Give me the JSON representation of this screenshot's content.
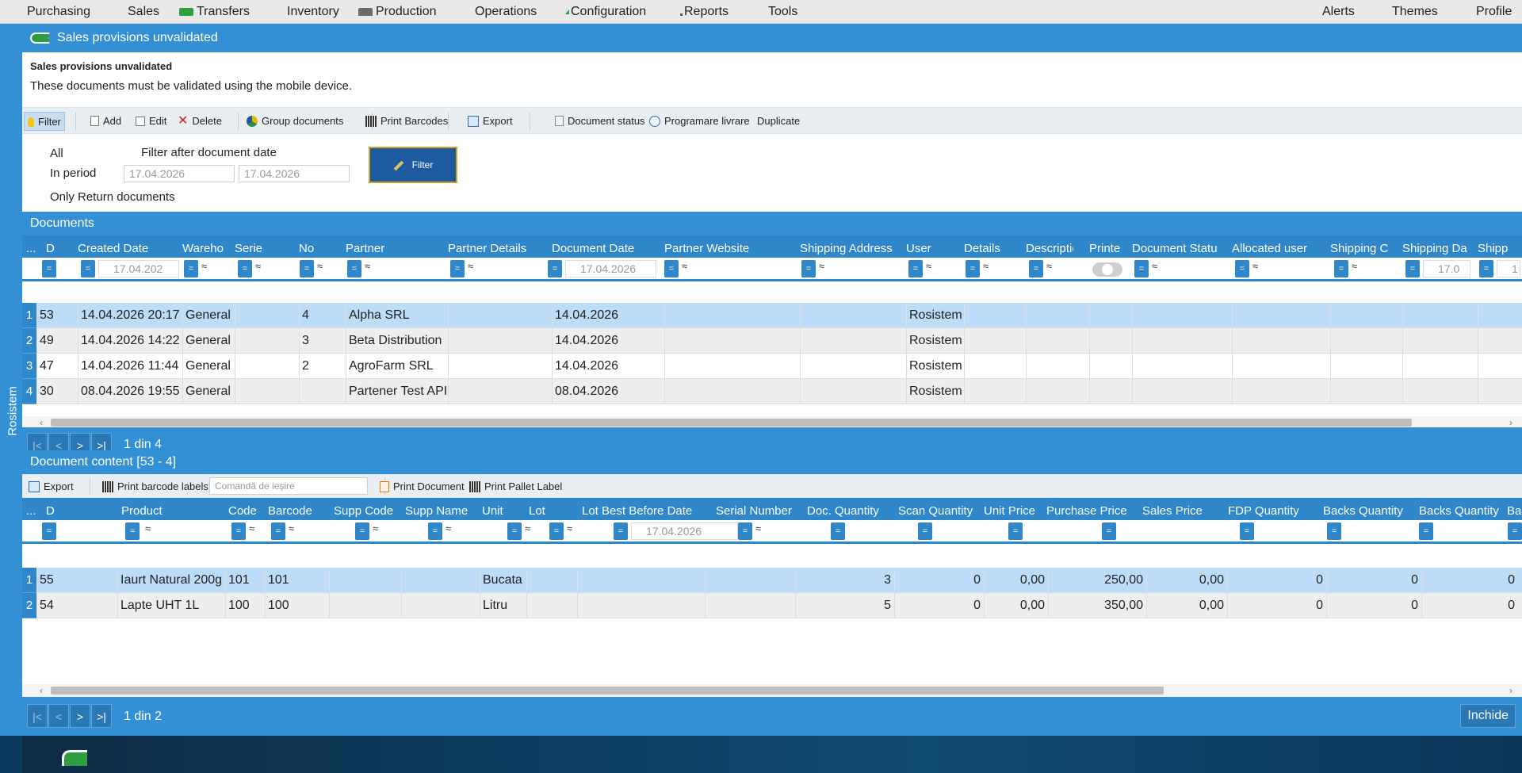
{
  "menu": {
    "left": [
      {
        "label": "Purchasing",
        "icon": ""
      },
      {
        "label": "Sales",
        "icon": ""
      },
      {
        "label": "Transfers",
        "icon": "truck-icon"
      },
      {
        "label": "Inventory",
        "icon": ""
      },
      {
        "label": "Production",
        "icon": "factory-icon"
      },
      {
        "label": "Operations",
        "icon": ""
      },
      {
        "label": "Configuration",
        "icon": "gear-icon"
      },
      {
        "label": "Reports",
        "icon": "report-icon"
      },
      {
        "label": "Tools",
        "icon": ""
      }
    ],
    "right": [
      "Alerts",
      "Themes",
      "Profile"
    ]
  },
  "sidetab": {
    "label": "Rosistem"
  },
  "window": {
    "title": "Sales provisions unvalidated",
    "info_title": "Sales provisions unvalidated",
    "info_text": "These documents must be validated using the mobile device."
  },
  "toolbar": {
    "filter": "Filter",
    "add": "Add",
    "edit": "Edit",
    "delete": "Delete",
    "group": "Group documents",
    "print_barcodes": "Print Barcodes",
    "export": "Export",
    "doc_status": "Document status",
    "programare": "Programare livrare",
    "duplicate": "Duplicate"
  },
  "filter": {
    "all": "All",
    "in_period": "In period",
    "after_date": "Filter after document date",
    "date_from": "17.04.2026",
    "date_to": "17.04.2026",
    "only_returns": "Only Return documents",
    "button": "Filter"
  },
  "documents": {
    "title": "Documents",
    "columns": [
      "...",
      "D",
      "Created Date",
      "Wareho",
      "Serie",
      "No",
      "Partner",
      "Partner Details",
      "Document Date",
      "Partner Website",
      "Shipping Address",
      "User",
      "Details",
      "Descriptio",
      "Printe",
      "Document Statu",
      "Allocated user",
      "Shipping C",
      "Shipping Da",
      "Shipp"
    ],
    "filter_dates": [
      "17.04.202",
      "17.04.2026",
      "17.0",
      "1"
    ],
    "rows": [
      {
        "n": "1",
        "id": "53",
        "created": "14.04.2026 20:17",
        "warehouse": "General",
        "no": "4",
        "partner": "Alpha SRL",
        "doc_date": "14.04.2026",
        "user": "Rosistem"
      },
      {
        "n": "2",
        "id": "49",
        "created": "14.04.2026 14:22",
        "warehouse": "General",
        "no": "3",
        "partner": "Beta Distribution",
        "doc_date": "14.04.2026",
        "user": "Rosistem"
      },
      {
        "n": "3",
        "id": "47",
        "created": "14.04.2026 11:44",
        "warehouse": "General",
        "no": "2",
        "partner": "AgroFarm SRL",
        "doc_date": "14.04.2026",
        "user": "Rosistem"
      },
      {
        "n": "4",
        "id": "30",
        "created": "08.04.2026 19:55",
        "warehouse": "General",
        "no": "",
        "partner": "Partener Test API",
        "doc_date": "08.04.2026",
        "user": "Rosistem"
      }
    ],
    "pager": {
      "first": "|<",
      "prev": "<",
      "next": ">",
      "last": ">|",
      "info": "1 din 4"
    }
  },
  "content": {
    "title": "Document content [53 - 4]",
    "toolbar": {
      "export": "Export",
      "print_labels": "Print barcode labels",
      "order_placeholder": "Comandă de ieșire",
      "print_doc": "Print Document",
      "print_pallet": "Print Pallet Label"
    },
    "columns": [
      "...",
      "D",
      "Product",
      "Code",
      "Barcode",
      "Supp Code",
      "Supp Name",
      "Unit",
      "Lot",
      "Lot Best Before Date",
      "Serial Number",
      "Doc. Quantity",
      "Scan Quantity",
      "Unit Price",
      "Purchase Price",
      "Sales Price",
      "FDP Quantity",
      "Backs Quantity",
      "Backs Quantity",
      "Ba"
    ],
    "filter_date": "17.04.2026",
    "rows": [
      {
        "n": "1",
        "id": "55",
        "product": "Iaurt Natural 200g",
        "code": "101",
        "barcode": "101",
        "unit": "Bucata",
        "doc_qty": "3",
        "scan_qty": "0",
        "unit_price": "0,00",
        "purchase": "250,00",
        "sales": "0,00",
        "fdp": "0",
        "backs1": "0",
        "backs2": "0"
      },
      {
        "n": "2",
        "id": "54",
        "product": "Lapte UHT 1L",
        "code": "100",
        "barcode": "100",
        "unit": "Litru",
        "doc_qty": "5",
        "scan_qty": "0",
        "unit_price": "0,00",
        "purchase": "350,00",
        "sales": "0,00",
        "fdp": "0",
        "backs1": "0",
        "backs2": "0"
      }
    ],
    "pager": {
      "first": "|<",
      "prev": "<",
      "next": ">",
      "last": ">|",
      "info": "1 din 2",
      "close": "Inchide"
    }
  },
  "colors": {
    "accent": "#3390d4",
    "header": "#2f86c8",
    "selected_row": "#bcdcf7"
  }
}
